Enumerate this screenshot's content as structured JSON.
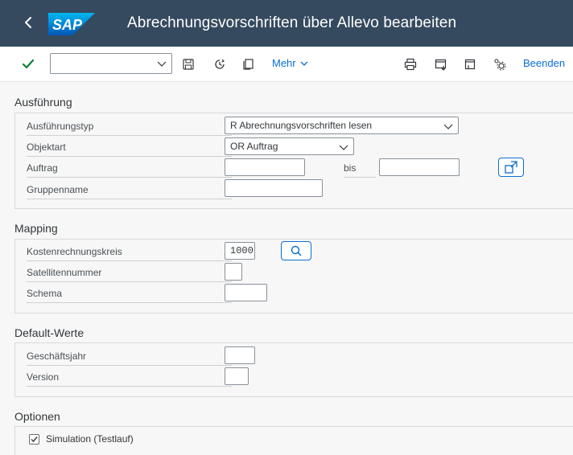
{
  "header": {
    "logo_text": "SAP",
    "title": "Abrechnungsvorschriften über Allevo bearbeiten"
  },
  "toolbar": {
    "variant_value": "",
    "more_label": "Mehr",
    "exit_label": "Beenden"
  },
  "sections": {
    "execution": {
      "title": "Ausführung",
      "execution_type_label": "Ausführungstyp",
      "execution_type_value": "R Abrechnungsvorschriften lesen",
      "object_type_label": "Objektart",
      "object_type_value": "OR Auftrag",
      "order_label": "Auftrag",
      "order_from_value": "",
      "to_label": "bis",
      "order_to_value": "",
      "group_name_label": "Gruppenname",
      "group_name_value": ""
    },
    "mapping": {
      "title": "Mapping",
      "controlling_area_label": "Kostenrechnungskreis",
      "controlling_area_value": "1000",
      "satellite_number_label": "Satellitennummer",
      "satellite_number_value": "",
      "schema_label": "Schema",
      "schema_value": ""
    },
    "defaults": {
      "title": "Default-Werte",
      "fiscal_year_label": "Geschäftsjahr",
      "fiscal_year_value": "",
      "version_label": "Version",
      "version_value": ""
    },
    "options": {
      "title": "Optionen",
      "simulation_label": "Simulation (Testlauf)",
      "simulation_checked": true
    }
  },
  "colors": {
    "shell": "#354a5f",
    "accent": "#0a6ed1",
    "confirm": "#107e3e"
  }
}
